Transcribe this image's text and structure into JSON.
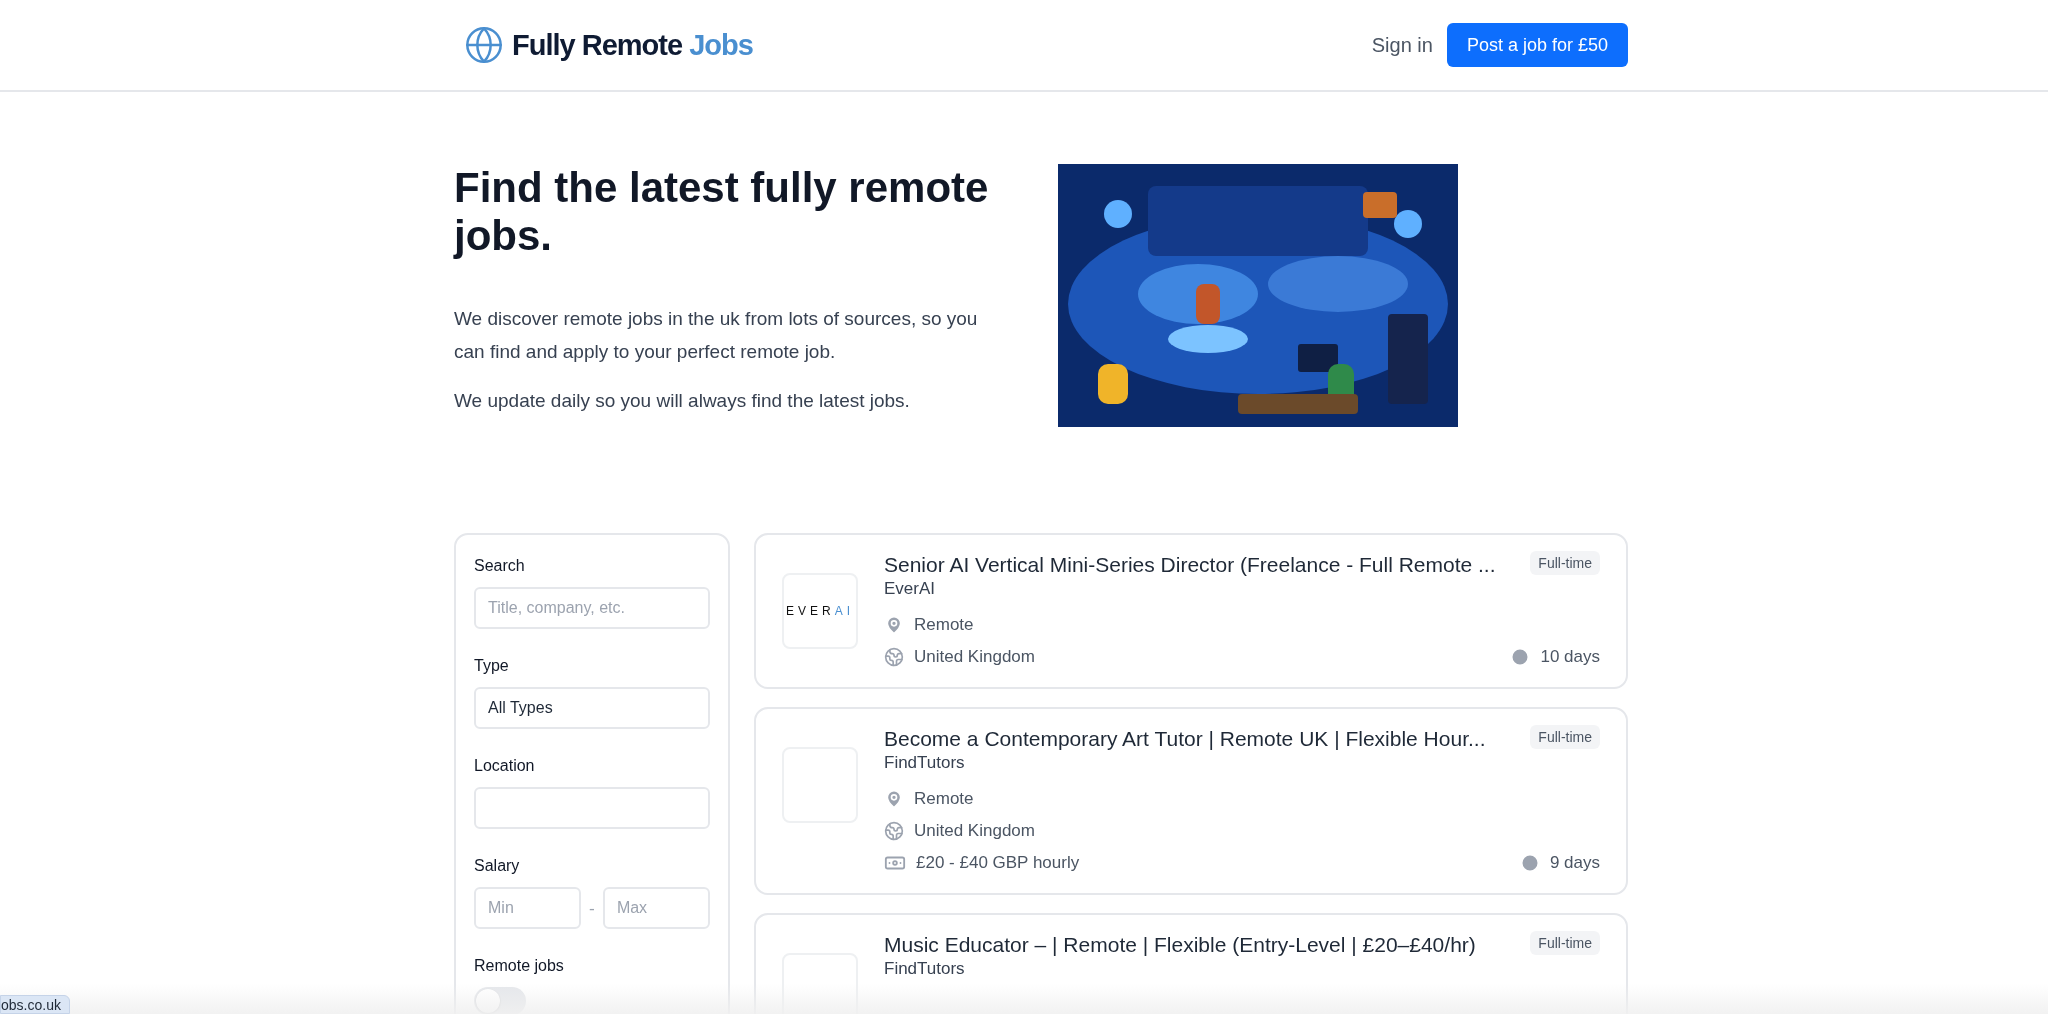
{
  "header": {
    "logo": {
      "main": "Fully Remote",
      "accent": "Jobs"
    },
    "sign_in": "Sign in",
    "post_button": "Post a job for £50"
  },
  "hero": {
    "title": "Find the latest fully remote jobs.",
    "paragraphs": [
      "We discover remote jobs in the uk from lots of sources, so you can find and apply to your perfect remote job.",
      "We update daily so you will always find the latest jobs."
    ],
    "image": {
      "kind": "picture"
    }
  },
  "filters": {
    "search": {
      "label": "Search",
      "placeholder": "Title, company, etc."
    },
    "type": {
      "label": "Type",
      "value": "All Types"
    },
    "location": {
      "label": "Location"
    },
    "salary": {
      "label": "Salary",
      "min_placeholder": "Min",
      "separator": "-",
      "max_placeholder": "Max"
    },
    "remote": {
      "label": "Remote jobs",
      "on": false
    }
  },
  "jobs": [
    {
      "title": "Senior AI Vertical Mini-Series Director (Freelance - Full Remote ...",
      "company": "EverAI",
      "logo": {
        "text": "EVER",
        "accent": "AI"
      },
      "type": "Full-time",
      "location": "Remote",
      "country": "United Kingdom",
      "age": "10 days"
    },
    {
      "title": "Become a Contemporary Art Tutor | Remote UK | Flexible Hour...",
      "company": "FindTutors",
      "type": "Full-time",
      "location": "Remote",
      "country": "United Kingdom",
      "salary": "£20 - £40 GBP hourly",
      "age": "9 days"
    },
    {
      "title": "Music Educator – | Remote | Flexible (Entry-Level | £20–£40/hr)",
      "company": "FindTutors",
      "type": "Full-time"
    }
  ],
  "status_bar": {
    "url": "obs.co.uk"
  }
}
